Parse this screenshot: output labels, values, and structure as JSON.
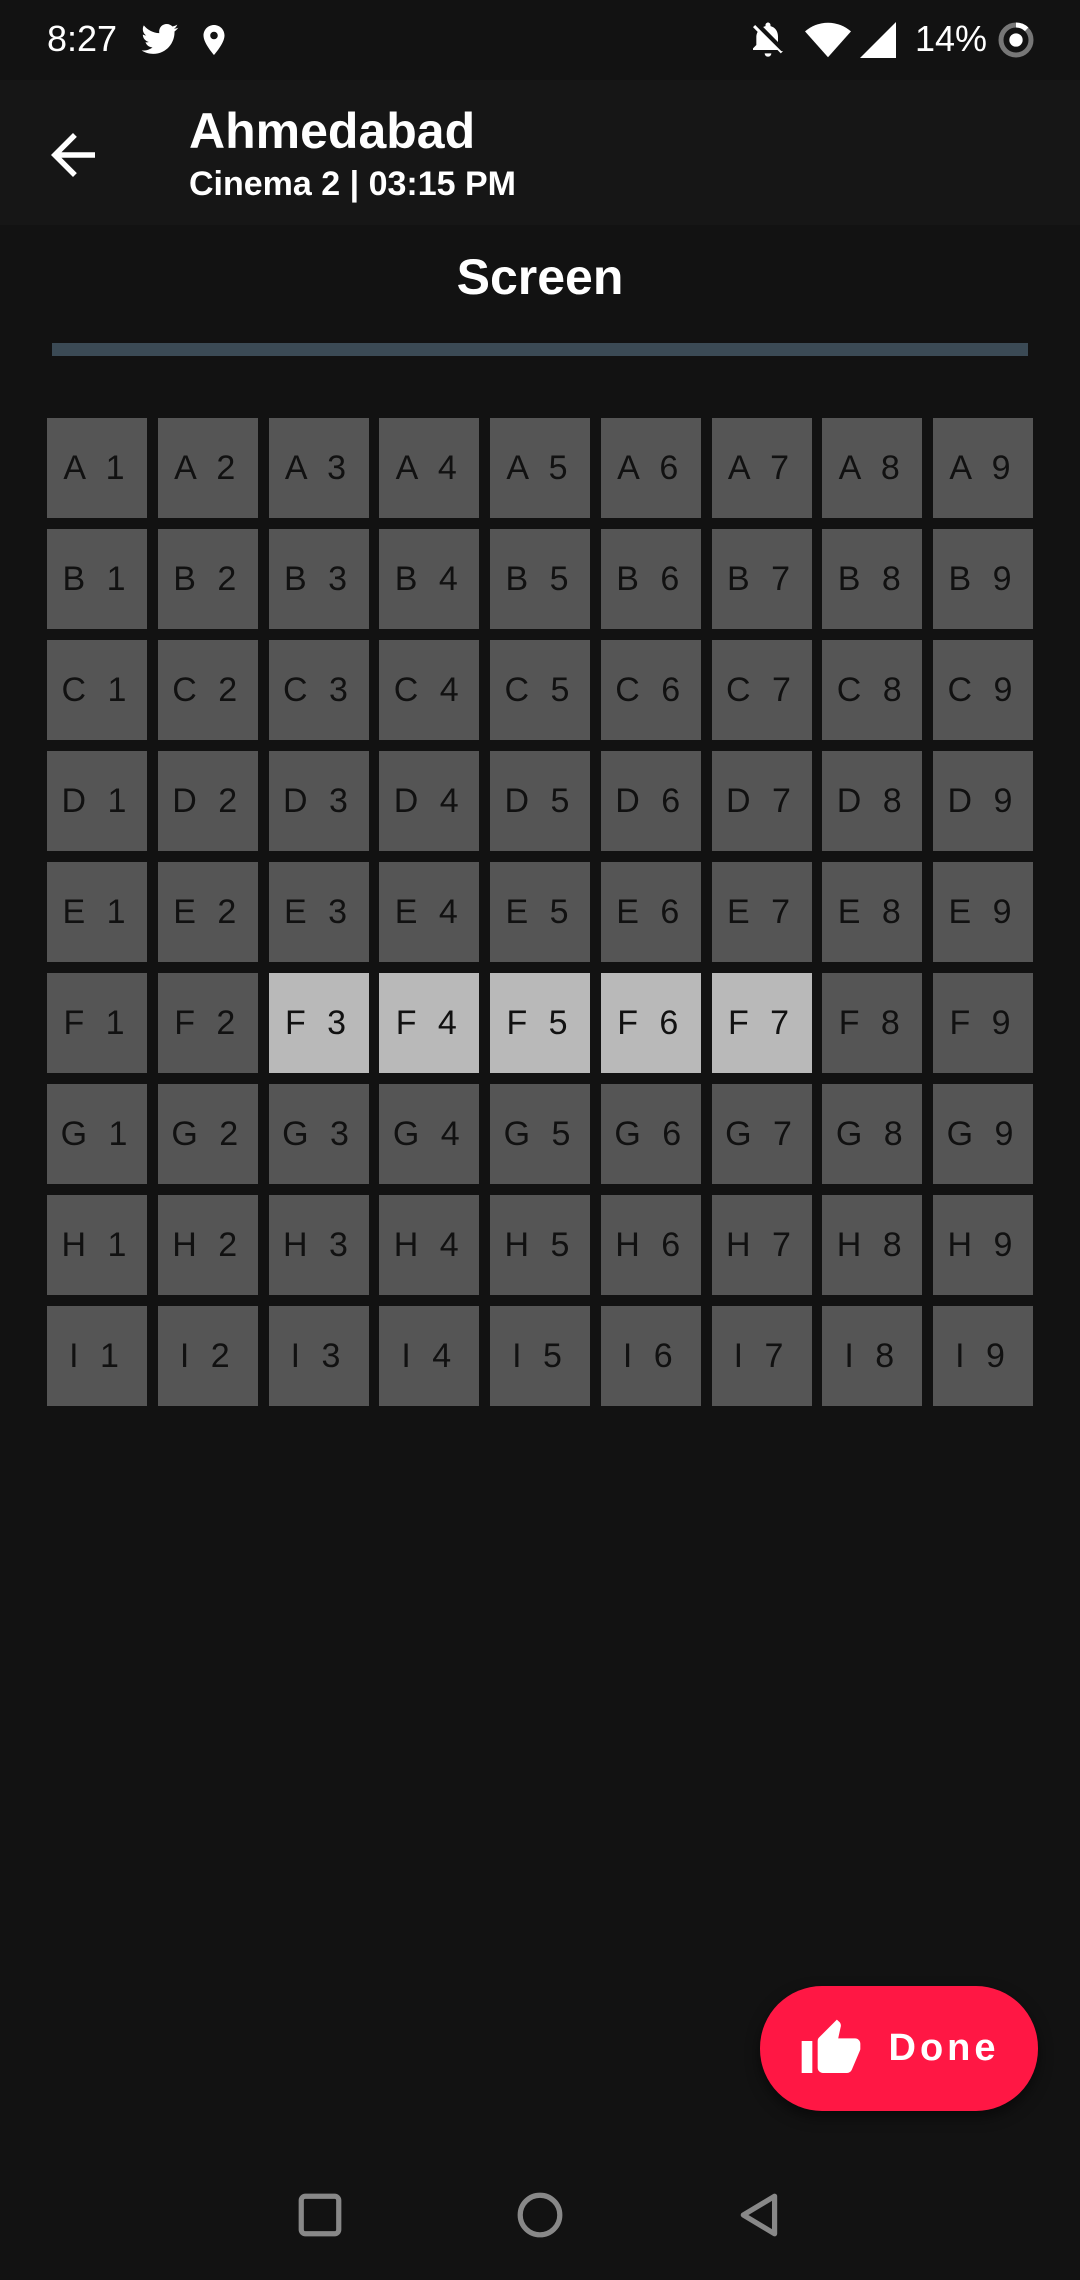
{
  "status": {
    "time": "8:27",
    "battery": "14%",
    "icons": [
      "twitter-icon",
      "location-pin-icon",
      "bell-off-icon",
      "wifi-icon",
      "signal-icon",
      "battery-ring-icon"
    ]
  },
  "header": {
    "title": "Ahmedabad",
    "subtitle": "Cinema 2 | 03:15 PM"
  },
  "screen_label": "Screen",
  "seats": [
    {
      "label": "A 1",
      "selected": false
    },
    {
      "label": "A 2",
      "selected": false
    },
    {
      "label": "A 3",
      "selected": false
    },
    {
      "label": "A 4",
      "selected": false
    },
    {
      "label": "A 5",
      "selected": false
    },
    {
      "label": "A 6",
      "selected": false
    },
    {
      "label": "A 7",
      "selected": false
    },
    {
      "label": "A 8",
      "selected": false
    },
    {
      "label": "A 9",
      "selected": false
    },
    {
      "label": "B 1",
      "selected": false
    },
    {
      "label": "B 2",
      "selected": false
    },
    {
      "label": "B 3",
      "selected": false
    },
    {
      "label": "B 4",
      "selected": false
    },
    {
      "label": "B 5",
      "selected": false
    },
    {
      "label": "B 6",
      "selected": false
    },
    {
      "label": "B 7",
      "selected": false
    },
    {
      "label": "B 8",
      "selected": false
    },
    {
      "label": "B 9",
      "selected": false
    },
    {
      "label": "C 1",
      "selected": false
    },
    {
      "label": "C 2",
      "selected": false
    },
    {
      "label": "C 3",
      "selected": false
    },
    {
      "label": "C 4",
      "selected": false
    },
    {
      "label": "C 5",
      "selected": false
    },
    {
      "label": "C 6",
      "selected": false
    },
    {
      "label": "C 7",
      "selected": false
    },
    {
      "label": "C 8",
      "selected": false
    },
    {
      "label": "C 9",
      "selected": false
    },
    {
      "label": "D 1",
      "selected": false
    },
    {
      "label": "D 2",
      "selected": false
    },
    {
      "label": "D 3",
      "selected": false
    },
    {
      "label": "D 4",
      "selected": false
    },
    {
      "label": "D 5",
      "selected": false
    },
    {
      "label": "D 6",
      "selected": false
    },
    {
      "label": "D 7",
      "selected": false
    },
    {
      "label": "D 8",
      "selected": false
    },
    {
      "label": "D 9",
      "selected": false
    },
    {
      "label": "E 1",
      "selected": false
    },
    {
      "label": "E 2",
      "selected": false
    },
    {
      "label": "E 3",
      "selected": false
    },
    {
      "label": "E 4",
      "selected": false
    },
    {
      "label": "E 5",
      "selected": false
    },
    {
      "label": "E 6",
      "selected": false
    },
    {
      "label": "E 7",
      "selected": false
    },
    {
      "label": "E 8",
      "selected": false
    },
    {
      "label": "E 9",
      "selected": false
    },
    {
      "label": "F 1",
      "selected": false
    },
    {
      "label": "F 2",
      "selected": false
    },
    {
      "label": "F 3",
      "selected": true
    },
    {
      "label": "F 4",
      "selected": true
    },
    {
      "label": "F 5",
      "selected": true
    },
    {
      "label": "F 6",
      "selected": true
    },
    {
      "label": "F 7",
      "selected": true
    },
    {
      "label": "F 8",
      "selected": false
    },
    {
      "label": "F 9",
      "selected": false
    },
    {
      "label": "G 1",
      "selected": false
    },
    {
      "label": "G 2",
      "selected": false
    },
    {
      "label": "G 3",
      "selected": false
    },
    {
      "label": "G 4",
      "selected": false
    },
    {
      "label": "G 5",
      "selected": false
    },
    {
      "label": "G 6",
      "selected": false
    },
    {
      "label": "G 7",
      "selected": false
    },
    {
      "label": "G 8",
      "selected": false
    },
    {
      "label": "G 9",
      "selected": false
    },
    {
      "label": "H 1",
      "selected": false
    },
    {
      "label": "H 2",
      "selected": false
    },
    {
      "label": "H 3",
      "selected": false
    },
    {
      "label": "H 4",
      "selected": false
    },
    {
      "label": "H 5",
      "selected": false
    },
    {
      "label": "H 6",
      "selected": false
    },
    {
      "label": "H 7",
      "selected": false
    },
    {
      "label": "H 8",
      "selected": false
    },
    {
      "label": "H 9",
      "selected": false
    },
    {
      "label": "I 1",
      "selected": false
    },
    {
      "label": "I 2",
      "selected": false
    },
    {
      "label": "I 3",
      "selected": false
    },
    {
      "label": "I 4",
      "selected": false
    },
    {
      "label": "I 5",
      "selected": false
    },
    {
      "label": "I 6",
      "selected": false
    },
    {
      "label": "I 7",
      "selected": false
    },
    {
      "label": "I 8",
      "selected": false
    },
    {
      "label": "I 9",
      "selected": false
    }
  ],
  "fab": {
    "label": "Done",
    "icon": "thumbs-up-icon"
  },
  "colors": {
    "background": "#121212",
    "seat_available": "#555555",
    "seat_selected": "#b9b9b9",
    "screen_bar": "#3b4a55",
    "accent": "#ff1744"
  },
  "navbar": {
    "icons": [
      "recents-square-icon",
      "home-circle-icon",
      "back-triangle-icon"
    ]
  }
}
